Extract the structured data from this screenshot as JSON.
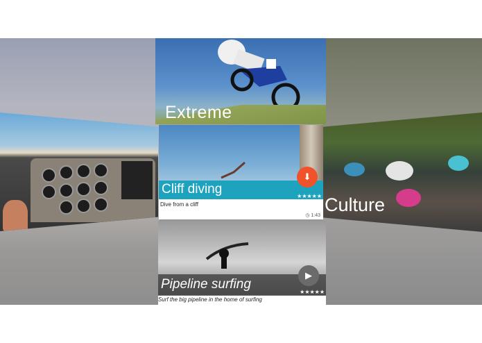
{
  "cards": {
    "extreme": {
      "title": "Extreme"
    },
    "culture": {
      "title": "Culture"
    },
    "cliff": {
      "title": "Cliff diving",
      "subtitle": "Dive from a cliff",
      "duration": "1:43",
      "rating": "★★★★★",
      "action_icon": "download-icon"
    },
    "surf": {
      "title": "Pipeline surfing",
      "subtitle": "Surf the big pipeline in the home of surfing",
      "rating": "★★★★★",
      "action_icon": "play-icon"
    }
  },
  "colors": {
    "accent": "#1da3be",
    "fab_orange": "#f0522b",
    "fab_gray": "#6b6b6b"
  }
}
